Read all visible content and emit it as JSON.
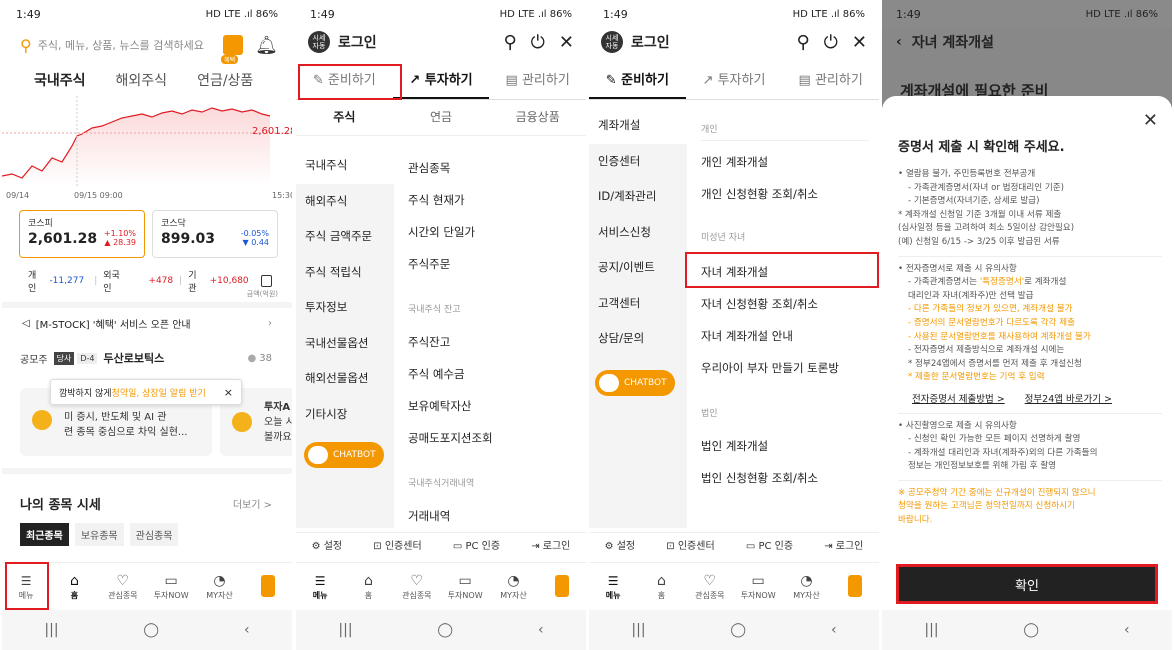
{
  "status": {
    "time": "1:49",
    "right": "HD LTE .ıl 86%"
  },
  "p1": {
    "search_placeholder": "주식, 메뉴, 상품, 뉴스를 검색하세요",
    "benefit_badge": "혜택",
    "tabs": [
      "국내주식",
      "해외주식",
      "연금/상품"
    ],
    "chart_last": "2,601.28",
    "x_labels": [
      "09/14",
      "09/15 09:00",
      "15:30"
    ],
    "kospi": {
      "name": "코스피",
      "value": "2,601.28",
      "pct": "+1.10%",
      "chg": "28.39"
    },
    "kosdaq": {
      "name": "코스닥",
      "value": "899.03",
      "pct": "-0.05%",
      "chg": "0.44"
    },
    "investors": [
      {
        "label": "개인",
        "value": "-11,277"
      },
      {
        "label": "외국인",
        "value": "+478"
      },
      {
        "label": "기관",
        "value": "+10,680"
      }
    ],
    "unit": "금액(억원)",
    "notice": "[M-STOCK] '혜택' 서비스 오픈 안내",
    "ipo_label": "공모주",
    "ipo_badge1": "당사",
    "ipo_badge2": "D-4",
    "ipo_name": "두산로보틱스",
    "ipo_count": "38",
    "tooltip_a": "깜박하지 않게 ",
    "tooltip_b": "청약일, 상장일 알림 받기",
    "tooltip_close": "×",
    "card1_line1": "미 증시, 반도체 및 AI 관",
    "card1_line2": "련 종목 중심으로 차익 실현...",
    "card2_title": "투자A",
    "card2_line1": "오늘 시",
    "card2_line2": "볼까요",
    "mystocks_title": "나의 종목 시세",
    "more": "더보기 >",
    "chips": [
      "최근종목",
      "보유종목",
      "관심종목"
    ]
  },
  "tabbar": [
    {
      "icon": "☰",
      "label": "메뉴"
    },
    {
      "icon": "⌂",
      "label": "홈"
    },
    {
      "icon": "♡",
      "label": "관심종목"
    },
    {
      "icon": "▭",
      "label": "투자NOW"
    },
    {
      "icon": "◔",
      "label": "MY자산"
    }
  ],
  "p2": {
    "logo": "시세\n자동",
    "login": "로그인",
    "top_tabs": [
      "준비하기",
      "투자하기",
      "관리하기"
    ],
    "sub_tabs": [
      "주식",
      "연금",
      "금융상품"
    ],
    "left_items": [
      "국내주식",
      "해외주식",
      "주식 금액주문",
      "주식 적립식",
      "투자정보",
      "국내선물옵션",
      "해외선물옵션",
      "기타시장"
    ],
    "right_items": [
      "관심종목",
      "주식 현재가",
      "시간외 단일가",
      "주식주문"
    ],
    "section2": "국내주식 잔고",
    "right_items2": [
      "주식잔고",
      "주식 예수금",
      "보유예탁자산",
      "공매도포지션조회"
    ],
    "section3": "국내주식거래내역",
    "right_items3": [
      "거래내역"
    ],
    "chatbot": "CHATBOT",
    "bottom_links": [
      "설정",
      "인증센터",
      "PC 인증",
      "로그인"
    ]
  },
  "p3": {
    "top_tabs": [
      "준비하기",
      "투자하기",
      "관리하기"
    ],
    "left_items": [
      "계좌개설",
      "인증센터",
      "ID/계좌관리",
      "서비스신청",
      "공지/이벤트",
      "고객센터",
      "상담/문의"
    ],
    "sec_personal": "개인",
    "personal_items": [
      "개인 계좌개설",
      "개인 신청현황 조회/취소"
    ],
    "sec_minor": "미성년 자녀",
    "minor_items": [
      "자녀 계좌개설",
      "자녀 신청현황 조회/취소",
      "자녀 계좌개설 안내",
      "우리아이 부자 만들기 토론방"
    ],
    "sec_corp": "법인",
    "corp_items": [
      "법인 계좌개설",
      "법인 신청현황 조회/취소"
    ]
  },
  "p4": {
    "header": "자녀 계좌개설",
    "bg_title": "계좌개설에 필요한 준비",
    "modal_title": "증명서 제출 시 확인해 주세요.",
    "b1": "열람용 불가, 주민등록번호 전부공개",
    "b1_l1": "- 가족관계증명서(자녀 or 법정대리인 기준)",
    "b1_l2": "- 기본증명서(자녀기준, 상세로 발급)",
    "b1_n1": "* 계좌개설 신청일 기준 3개월 이내 서류 제출",
    "b1_n2": "(심사일정 등을 고려하여 최소 5일이상 감안필요)",
    "b1_n3": "(예) 신청일 6/15 -> 3/25 이후 발급된 서류",
    "b2": "전자증명서로 제출 시 유의사항",
    "b2_l1a": "- 가족관계증명서는 ",
    "b2_l1b": "'특정증명서'",
    "b2_l1c": "로 계좌개설",
    "b2_l2": "대리인과 자녀(계좌주)만 선택 발급",
    "b2_o1": "- 다른 가족들의 정보가 있으면, 계좌개설 불가",
    "b2_o2": "- 증명서의 문서열람번호가 다르도록 각각 제출",
    "b2_o3": "- 사용된 문서열람번호를 재사용하여 계좌개설 불가",
    "b2_l3": "- 전자증명서 제출방식으로 계좌개설 시에는",
    "b2_l4": "* 정부24앱에서 증명서를 먼저 제출 후 개설신청",
    "b2_o4": "* 제출한 문서열람번호는 기억 후 입력",
    "link1": "전자증명서 제출방법 >",
    "link2": "정부24앱 바로가기 >",
    "b3": "사진촬영으로 제출 시 유의사항",
    "b3_l1": "- 신청인 확인 가능한 모든 페이지 선명하게 촬영",
    "b3_l2": "- 계좌개설 대리인과 자녀(계좌주)외의 다른 가족들의",
    "b3_l3": "정보는 개인정보보호를 위해 가림 후 촬영",
    "warn1": "※ 공모주청약 기간 중에는 신규개설이 진행되지 않으니",
    "warn2": "청약을 원하는 고객님은 청약전일까지 신청하시기",
    "warn3": "바랍니다.",
    "confirm": "확인"
  },
  "colors": {
    "accent": "#f39800",
    "red": "#e01b22",
    "up": "#e01b22",
    "down": "#1a56d6"
  }
}
